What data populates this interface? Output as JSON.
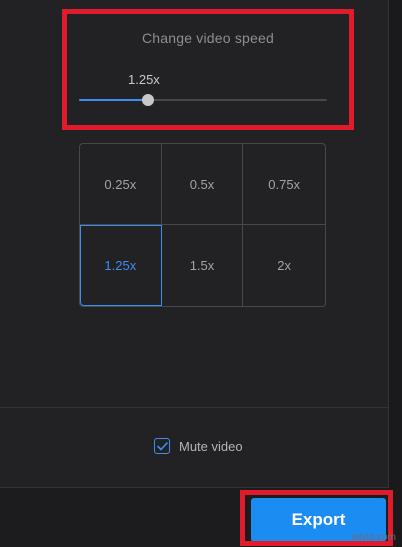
{
  "speed": {
    "title": "Change video speed",
    "value_label": "1.25x",
    "slider_fraction": 0.28
  },
  "speed_options": [
    {
      "label": "0.25x",
      "selected": false
    },
    {
      "label": "0.5x",
      "selected": false
    },
    {
      "label": "0.75x",
      "selected": false
    },
    {
      "label": "1.25x",
      "selected": true
    },
    {
      "label": "1.5x",
      "selected": false
    },
    {
      "label": "2x",
      "selected": false
    }
  ],
  "mute": {
    "label": "Mute video",
    "checked": true
  },
  "export": {
    "label": "Export"
  },
  "watermark": "wtvid.com",
  "colors": {
    "accent": "#1b8cf2",
    "selected_text": "#3d8ef0",
    "highlight": "#e01b2c"
  }
}
